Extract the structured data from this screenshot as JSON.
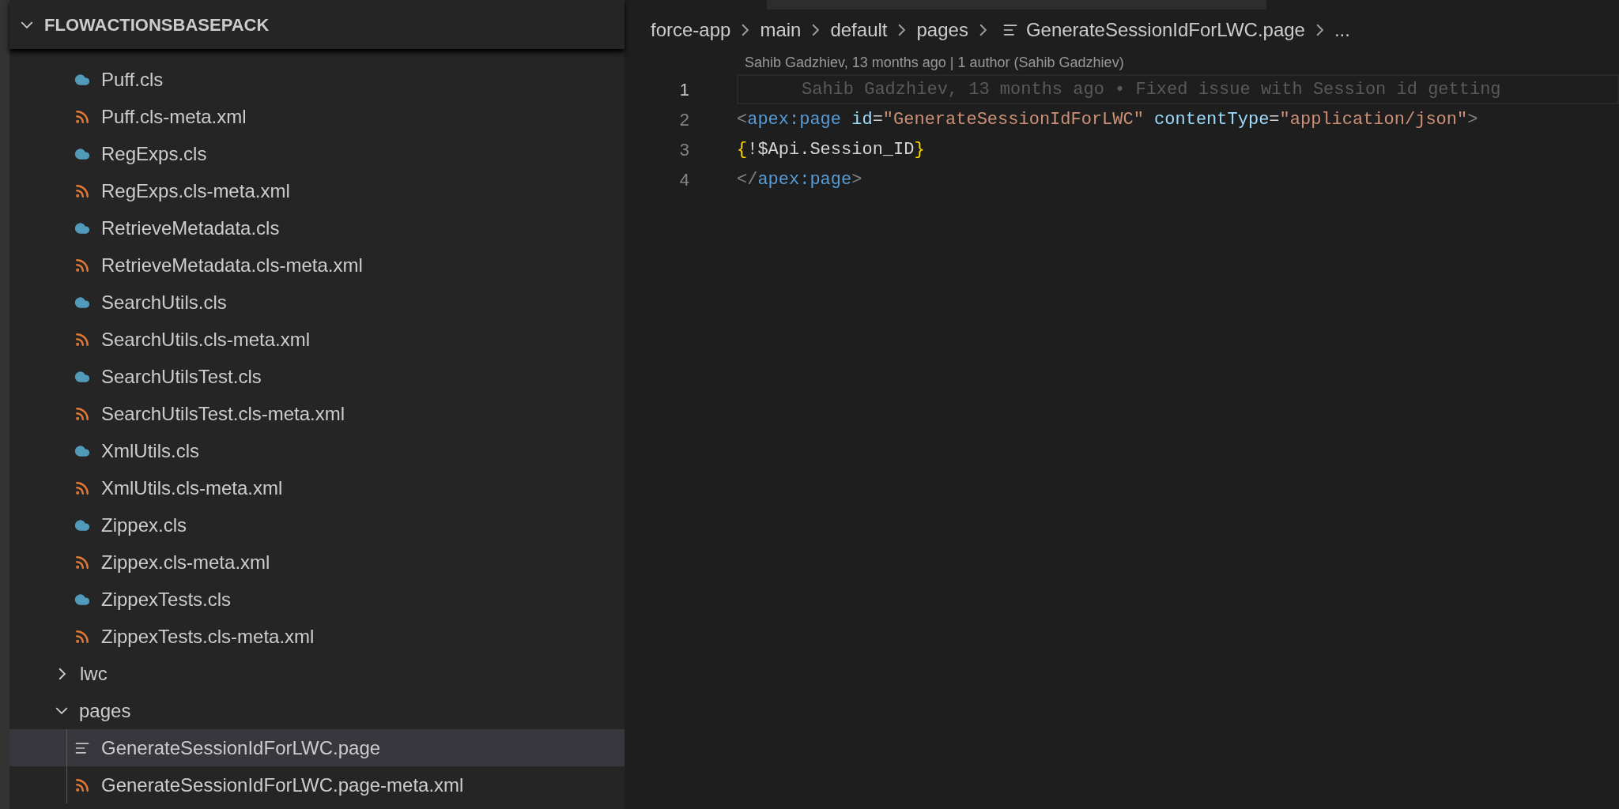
{
  "explorer": {
    "title": "FLOWACTIONSBASEPACK",
    "expanded": true,
    "files": [
      {
        "name": "Puff.cls",
        "kind": "apex",
        "selected": false
      },
      {
        "name": "Puff.cls-meta.xml",
        "kind": "xml",
        "selected": false
      },
      {
        "name": "RegExps.cls",
        "kind": "apex",
        "selected": false
      },
      {
        "name": "RegExps.cls-meta.xml",
        "kind": "xml",
        "selected": false
      },
      {
        "name": "RetrieveMetadata.cls",
        "kind": "apex",
        "selected": false
      },
      {
        "name": "RetrieveMetadata.cls-meta.xml",
        "kind": "xml",
        "selected": false
      },
      {
        "name": "SearchUtils.cls",
        "kind": "apex",
        "selected": false
      },
      {
        "name": "SearchUtils.cls-meta.xml",
        "kind": "xml",
        "selected": false
      },
      {
        "name": "SearchUtilsTest.cls",
        "kind": "apex",
        "selected": false
      },
      {
        "name": "SearchUtilsTest.cls-meta.xml",
        "kind": "xml",
        "selected": false
      },
      {
        "name": "XmlUtils.cls",
        "kind": "apex",
        "selected": false
      },
      {
        "name": "XmlUtils.cls-meta.xml",
        "kind": "xml",
        "selected": false
      },
      {
        "name": "Zippex.cls",
        "kind": "apex",
        "selected": false
      },
      {
        "name": "Zippex.cls-meta.xml",
        "kind": "xml",
        "selected": false
      },
      {
        "name": "ZippexTests.cls",
        "kind": "apex",
        "selected": false
      },
      {
        "name": "ZippexTests.cls-meta.xml",
        "kind": "xml",
        "selected": false
      }
    ],
    "folders": [
      {
        "name": "lwc",
        "expanded": false
      },
      {
        "name": "pages",
        "expanded": true,
        "children": [
          {
            "name": "GenerateSessionIdForLWC.page",
            "kind": "page",
            "selected": true
          },
          {
            "name": "GenerateSessionIdForLWC.page-meta.xml",
            "kind": "xml",
            "selected": false
          }
        ]
      }
    ]
  },
  "editor": {
    "breadcrumb": [
      {
        "label": "force-app",
        "kind": "folder"
      },
      {
        "label": "main",
        "kind": "folder"
      },
      {
        "label": "default",
        "kind": "folder"
      },
      {
        "label": "pages",
        "kind": "folder"
      },
      {
        "label": "GenerateSessionIdForLWC.page",
        "kind": "file"
      },
      {
        "label": "...",
        "kind": "more"
      }
    ],
    "codelens": "Sahib Gadzhiev, 13 months ago | 1 author (Sahib Gadzhiev)",
    "lines": [
      {
        "number": "1",
        "current": true,
        "blame": "Sahib Gadzhiev, 13 months ago • Fixed issue with Session id getting"
      },
      {
        "number": "2",
        "current": false,
        "tokens": [
          {
            "text": "<",
            "kind": "punct"
          },
          {
            "text": "apex:page",
            "kind": "tag"
          },
          {
            "text": " id",
            "kind": "attr"
          },
          {
            "text": "=",
            "kind": "plain"
          },
          {
            "text": "\"GenerateSessionIdForLWC\"",
            "kind": "string"
          },
          {
            "text": " contentType",
            "kind": "attr"
          },
          {
            "text": "=",
            "kind": "plain"
          },
          {
            "text": "\"application/json\"",
            "kind": "string"
          },
          {
            "text": ">",
            "kind": "punct"
          }
        ]
      },
      {
        "number": "3",
        "current": false,
        "tokens": [
          {
            "text": "{",
            "kind": "brace"
          },
          {
            "text": "!$Api.Session_ID",
            "kind": "plain"
          },
          {
            "text": "}",
            "kind": "brace"
          }
        ]
      },
      {
        "number": "4",
        "current": false,
        "tokens": [
          {
            "text": "</",
            "kind": "punct"
          },
          {
            "text": "apex:page",
            "kind": "tag"
          },
          {
            "text": ">",
            "kind": "punct"
          }
        ]
      }
    ]
  }
}
